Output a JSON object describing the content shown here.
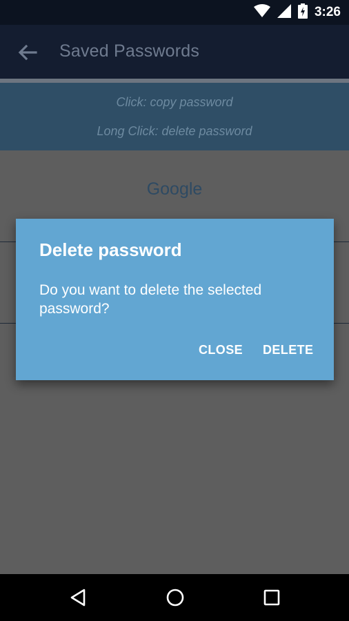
{
  "status_bar": {
    "time": "3:26",
    "icons": [
      "wifi-icon",
      "cell-signal-icon",
      "battery-charging-icon"
    ]
  },
  "app_bar": {
    "title": "Saved Passwords",
    "back_icon": "arrow-back-icon"
  },
  "hints": {
    "click": "Click: copy password",
    "long_click": "Long Click: delete password"
  },
  "list": {
    "items": [
      {
        "title": "Google"
      }
    ]
  },
  "dialog": {
    "title": "Delete password",
    "message": "Do you want to delete the selected password?",
    "close_label": "CLOSE",
    "delete_label": "DELETE"
  },
  "nav_bar": {
    "buttons": [
      "back-triangle-icon",
      "home-circle-icon",
      "recents-square-icon"
    ]
  },
  "colors": {
    "dialog_bg": "#62a6d2",
    "app_bar_bg": "#141d30",
    "hint_panel_bg": "#2f4e66",
    "scrim_bg": "#5f5f5f"
  }
}
